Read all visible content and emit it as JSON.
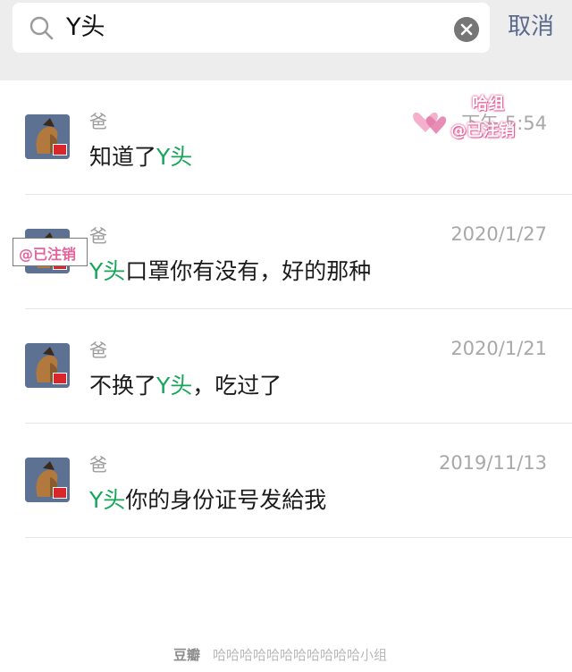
{
  "search": {
    "query": "Y头",
    "cancel_label": "取消"
  },
  "results": [
    {
      "name": "爸",
      "date": "下午 5:54",
      "text_before": "知道了",
      "highlight": "Y头",
      "text_after": ""
    },
    {
      "name": "爸",
      "date": "2020/1/27",
      "text_before": "",
      "highlight": "Y头",
      "text_after": "口罩你有没有，好的那种"
    },
    {
      "name": "爸",
      "date": "2020/1/21",
      "text_before": "不换了",
      "highlight": "Y头",
      "text_after": "，吃过了"
    },
    {
      "name": "爸",
      "date": "2019/11/13",
      "text_before": "",
      "highlight": "Y头",
      "text_after": "你的身份证号发給我"
    }
  ],
  "watermarks": {
    "stamp_top_word": "哈组",
    "stamp_tag": "@已注销",
    "stamp_box_tag": "@已注销",
    "footer_brand": "豆瓣",
    "footer_text": "哈哈哈哈哈哈哈哈哈哈哈小组"
  },
  "colors": {
    "highlight": "#17a55a",
    "cancel": "#5b6a8c",
    "watermark_pink": "#e5639b"
  }
}
